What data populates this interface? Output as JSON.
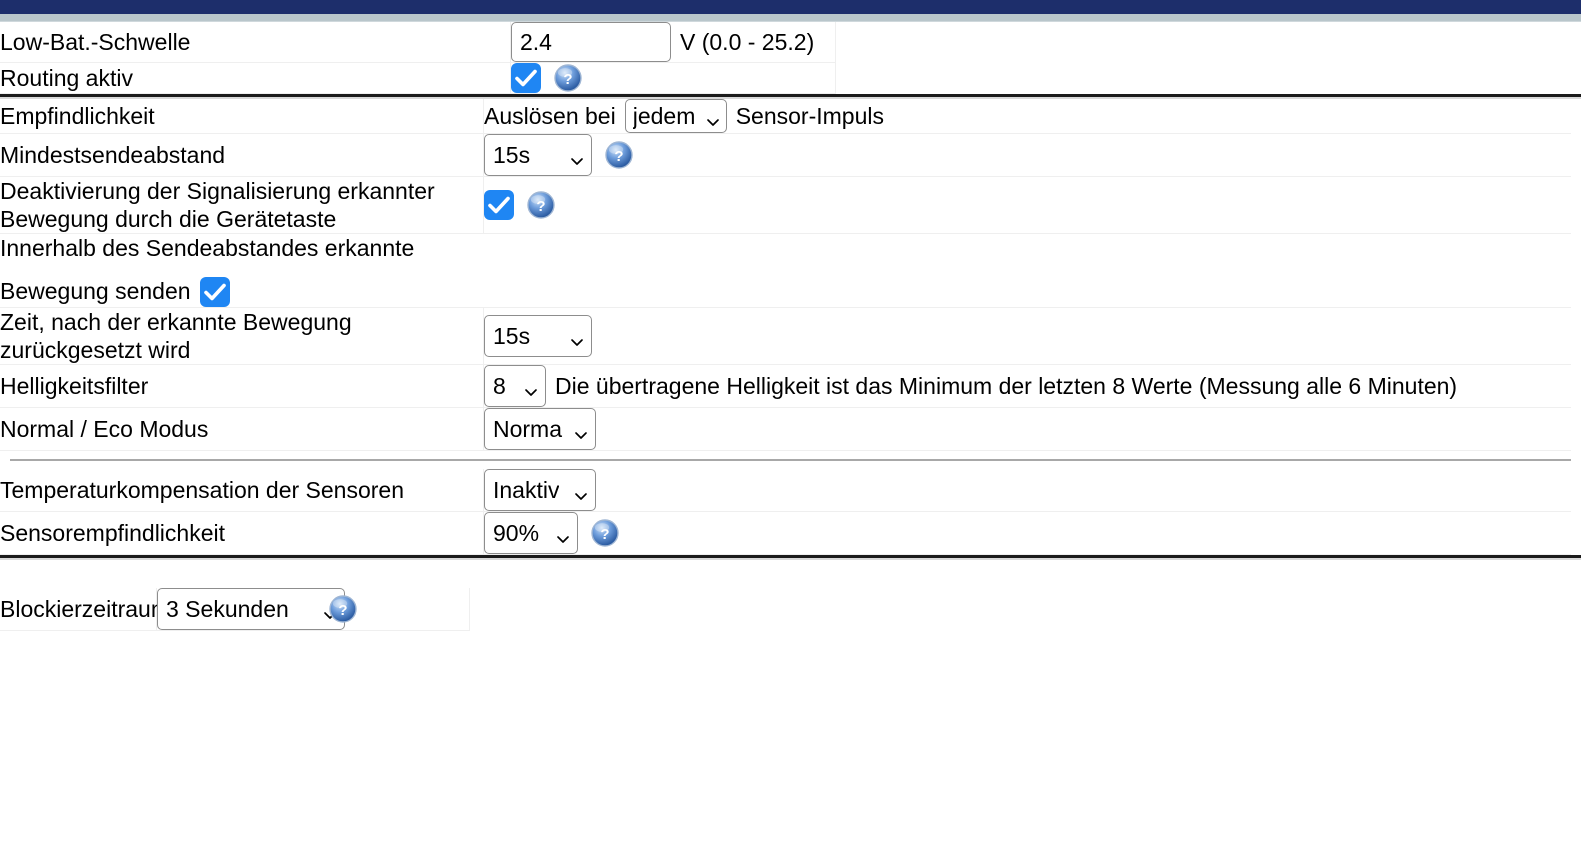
{
  "window": {
    "title_bar_color": "#1d2e6b",
    "sub_bar_color": "#b9c6cb"
  },
  "colors": {
    "checkbox_blue": "#1f86f3",
    "help_blue": "#2e6bbf",
    "divider_dark": "#1b1b1b",
    "divider_light": "#a8a8a8"
  },
  "section_battery": {
    "rows": [
      {
        "label": "Low-Bat.-Schwelle",
        "input_value": "2.4",
        "unit": "V (0.0 - 25.2)"
      },
      {
        "label": "Routing aktiv",
        "checkbox_checked": "true",
        "help": "?"
      }
    ]
  },
  "section_motion": {
    "rows": [
      {
        "label": "Empfindlichkeit",
        "prefix": "Auslösen bei",
        "select_value": "jedem",
        "suffix": "Sensor-Impuls"
      },
      {
        "label": "Mindestsendeabstand",
        "select_value": "15s",
        "help": "?"
      },
      {
        "label": "Deaktivierung der Signalisierung erkannter Bewegung durch die Gerätetaste",
        "checkbox_checked": "true",
        "help": "?"
      },
      {
        "label_line1": "Innerhalb des Sendeabstandes erkannte",
        "label_line2": "Bewegung senden",
        "checkbox_checked": "true"
      },
      {
        "label": "Zeit, nach der erkannte Bewegung zurückgesetzt wird",
        "select_value": "15s"
      },
      {
        "label": "Helligkeitsfilter",
        "select_value": "8",
        "hint": "Die übertragene Helligkeit ist das Minimum der letzten 8 Werte (Messung alle 6 Minuten)"
      },
      {
        "label": "Normal / Eco Modus",
        "select_value": "Normal"
      }
    ]
  },
  "section_sensor": {
    "rows": [
      {
        "label": "Temperaturkompensation der Sensoren",
        "select_value": "Inaktiv"
      },
      {
        "label": "Sensorempfindlichkeit",
        "select_value": "90%",
        "help": "?"
      }
    ]
  },
  "section_block": {
    "label": "Blockierzeitraum",
    "select_value": "3 Sekunden",
    "help": "?"
  },
  "icons": {
    "chevron_down": "chevron-down-icon",
    "check": "check-icon",
    "help": "help-icon"
  }
}
